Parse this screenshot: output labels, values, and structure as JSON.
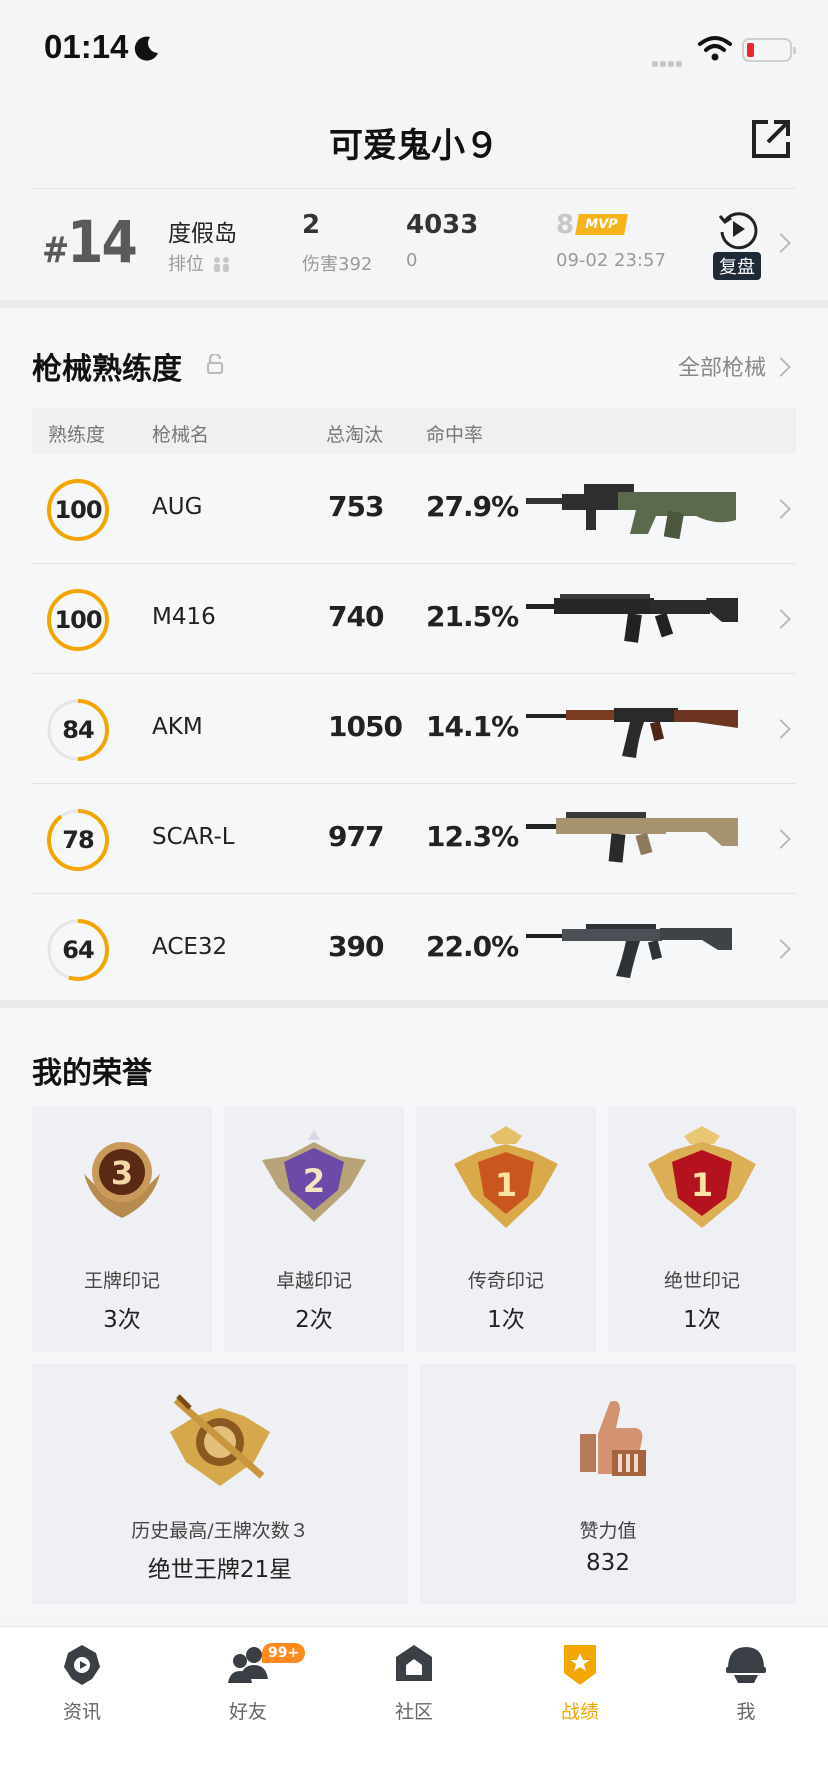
{
  "status_bar": {
    "time": "01:14"
  },
  "header": {
    "title": "可爱鬼小９"
  },
  "match": {
    "rank_hash": "#",
    "rank_num": "14",
    "map": "度假岛",
    "mode": "排位",
    "kills": "2",
    "damage": "伤害392",
    "score": "4033",
    "score_sub": "0",
    "mvp_rank": "8",
    "mvp_label": "MVP",
    "datetime": "09-02 23:57",
    "replay_label": "复盘"
  },
  "weapons": {
    "title": "枪械熟练度",
    "all_link": "全部枪械",
    "columns": [
      "熟练度",
      "枪械名",
      "总淘汰",
      "命中率"
    ],
    "rows": [
      {
        "level": "100",
        "progress": 1.0,
        "name": "AUG",
        "kills": "753",
        "hit_rate": "27.9%",
        "icon": "aug-rifle"
      },
      {
        "level": "100",
        "progress": 1.0,
        "name": "M416",
        "kills": "740",
        "hit_rate": "21.5%",
        "icon": "m416-rifle"
      },
      {
        "level": "84",
        "progress": 0.5,
        "name": "AKM",
        "kills": "1050",
        "hit_rate": "14.1%",
        "icon": "akm-rifle"
      },
      {
        "level": "78",
        "progress": 0.9,
        "name": "SCAR-L",
        "kills": "977",
        "hit_rate": "12.3%",
        "icon": "scar-rifle"
      },
      {
        "level": "64",
        "progress": 0.55,
        "name": "ACE32",
        "kills": "390",
        "hit_rate": "22.0%",
        "icon": "ace32-rifle"
      }
    ]
  },
  "honors": {
    "title": "我的荣誉",
    "items": [
      {
        "label": "王牌印记",
        "count": "3次",
        "medal_number": "3"
      },
      {
        "label": "卓越印记",
        "count": "2次",
        "medal_number": "2"
      },
      {
        "label": "传奇印记",
        "count": "1次",
        "medal_number": "1"
      },
      {
        "label": "绝世印记",
        "count": "1次",
        "medal_number": "1"
      }
    ],
    "history_label": "历史最高/王牌次数３",
    "history_value": "绝世王牌21星",
    "likes_label": "赞力值",
    "likes_value": "832"
  },
  "tabbar": {
    "tabs": [
      {
        "label": "资讯",
        "icon": "news-icon"
      },
      {
        "label": "好友",
        "icon": "friends-icon"
      },
      {
        "label": "社区",
        "icon": "community-icon"
      },
      {
        "label": "战绩",
        "icon": "record-icon"
      },
      {
        "label": "我",
        "icon": "me-icon"
      }
    ],
    "friends_badge": "99+",
    "active": "战绩"
  },
  "colors": {
    "accent": "#f2a600",
    "ring_track": "#e5e5e5",
    "mvp": "#f5b51a",
    "badge": "#ff8a1d"
  }
}
